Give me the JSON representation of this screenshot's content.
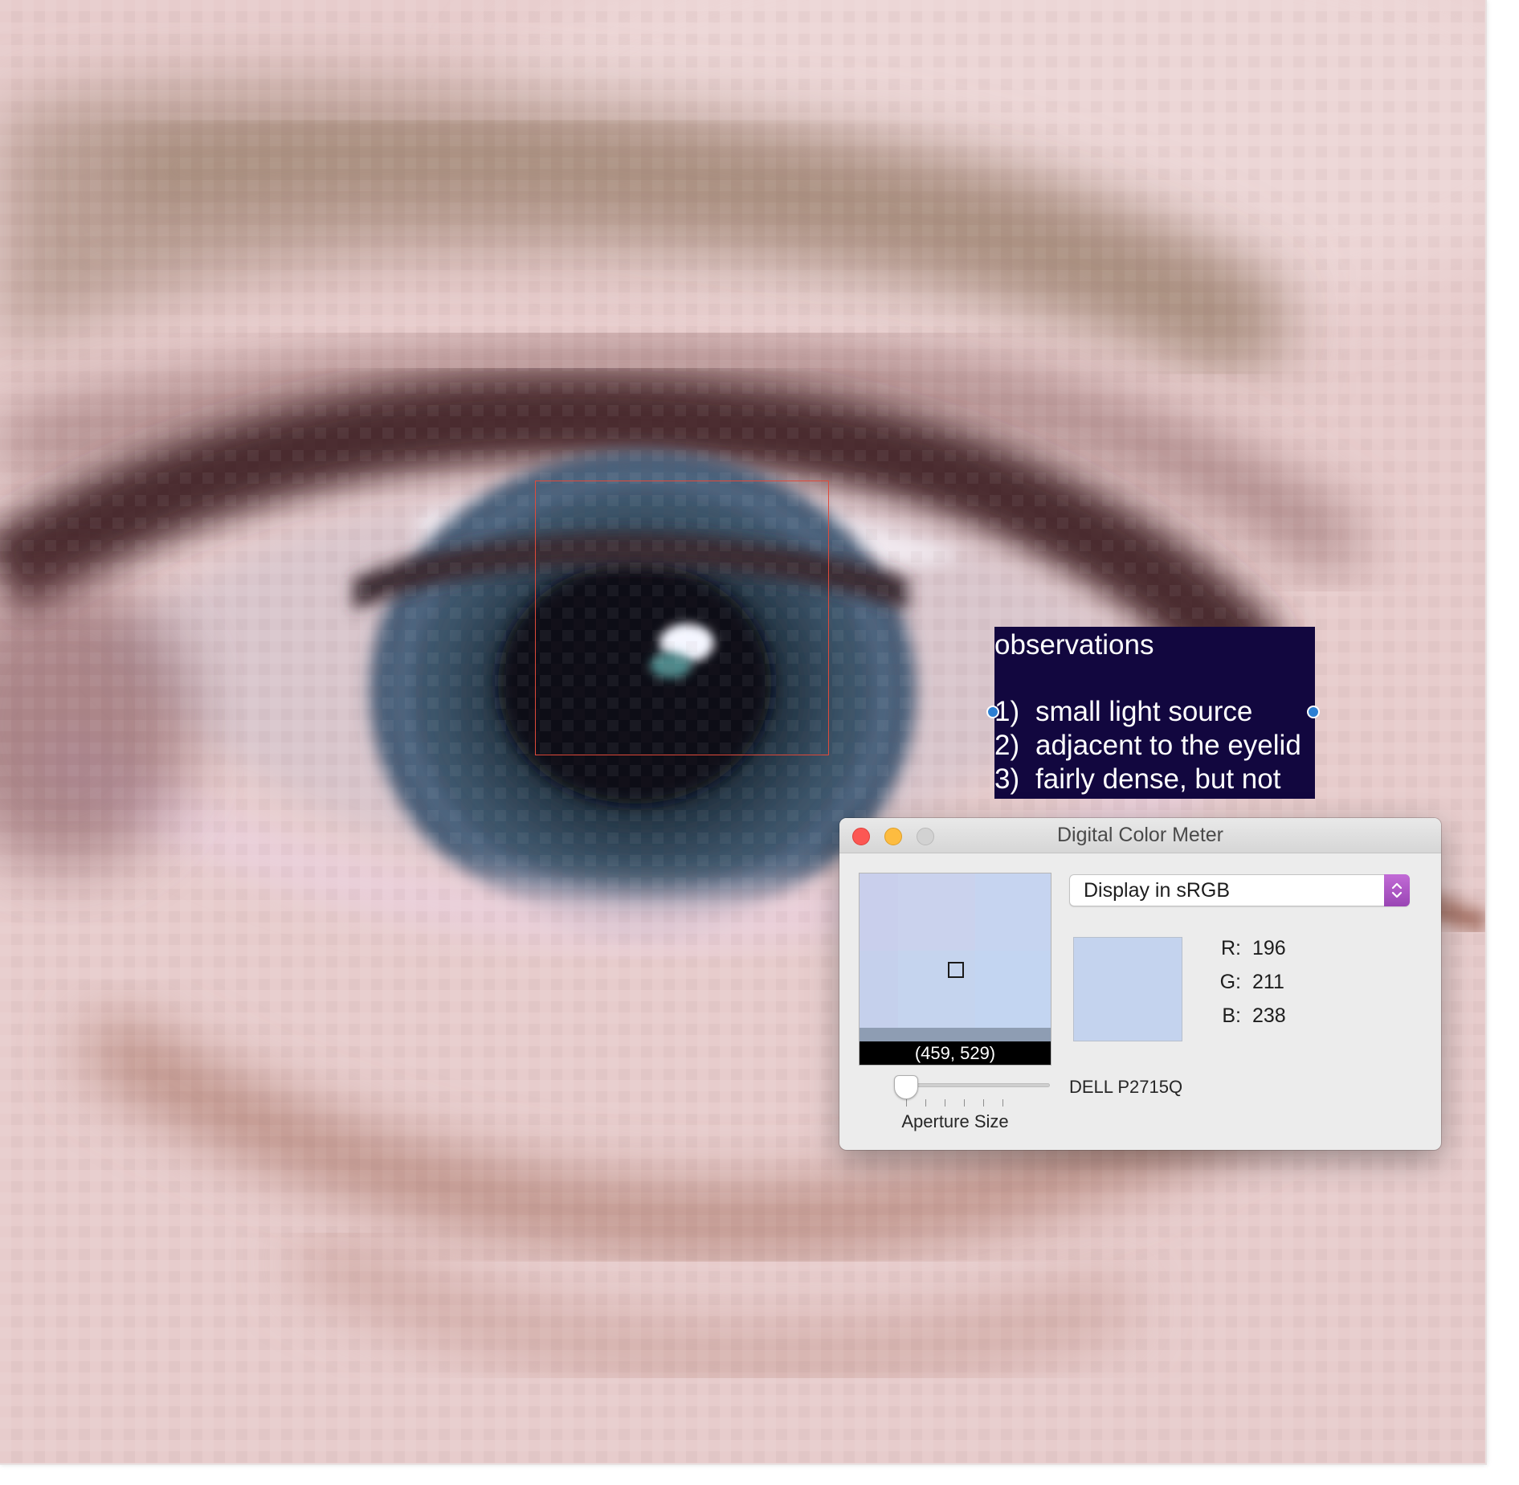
{
  "annotation": {
    "title": "observations",
    "items": [
      {
        "num": "1)",
        "text": "small light source"
      },
      {
        "num": "2)",
        "text": "adjacent to the eyelid"
      },
      {
        "num": "3)",
        "text": "fairly dense, but not"
      }
    ],
    "background_color": "#12073f"
  },
  "selection_color": "#e04a3a",
  "color_meter": {
    "window_title": "Digital Color Meter",
    "display_mode": "Display in sRGB",
    "coordinates": "(459, 529)",
    "aperture_label": "Aperture Size",
    "aperture_size_fraction": 0.0,
    "monitor": "DELL P2715Q",
    "sample_color": "#c4d3ee",
    "rgb": [
      {
        "key": "R:",
        "value": "196"
      },
      {
        "key": "G:",
        "value": "211"
      },
      {
        "key": "B:",
        "value": "238"
      }
    ]
  }
}
